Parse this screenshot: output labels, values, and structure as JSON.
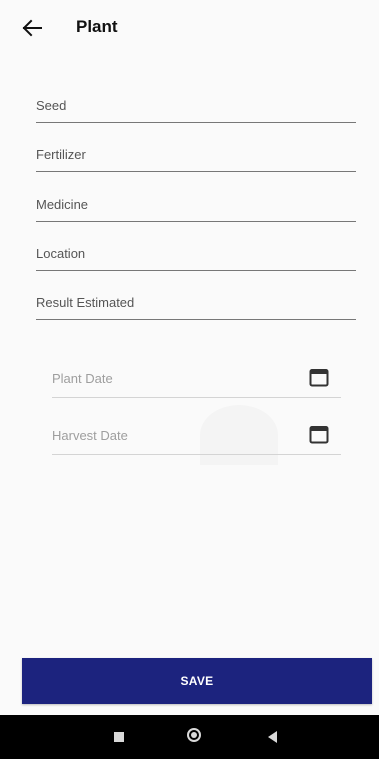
{
  "appbar": {
    "title": "Plant",
    "back_icon": "arrow-left-icon"
  },
  "form": {
    "fields": [
      {
        "label": "Seed"
      },
      {
        "label": "Fertilizer"
      },
      {
        "label": "Medicine"
      },
      {
        "label": "Location"
      },
      {
        "label": "Result Estimated"
      }
    ],
    "dates": [
      {
        "label": "Plant Date",
        "icon": "calendar-icon"
      },
      {
        "label": "Harvest Date",
        "icon": "calendar-icon"
      }
    ]
  },
  "save_button": {
    "label": "SAVE",
    "color": "#1c237e"
  },
  "system_nav": {
    "recents_icon": "square-icon",
    "home_icon": "circle-icon",
    "back_icon": "triangle-back-icon"
  }
}
